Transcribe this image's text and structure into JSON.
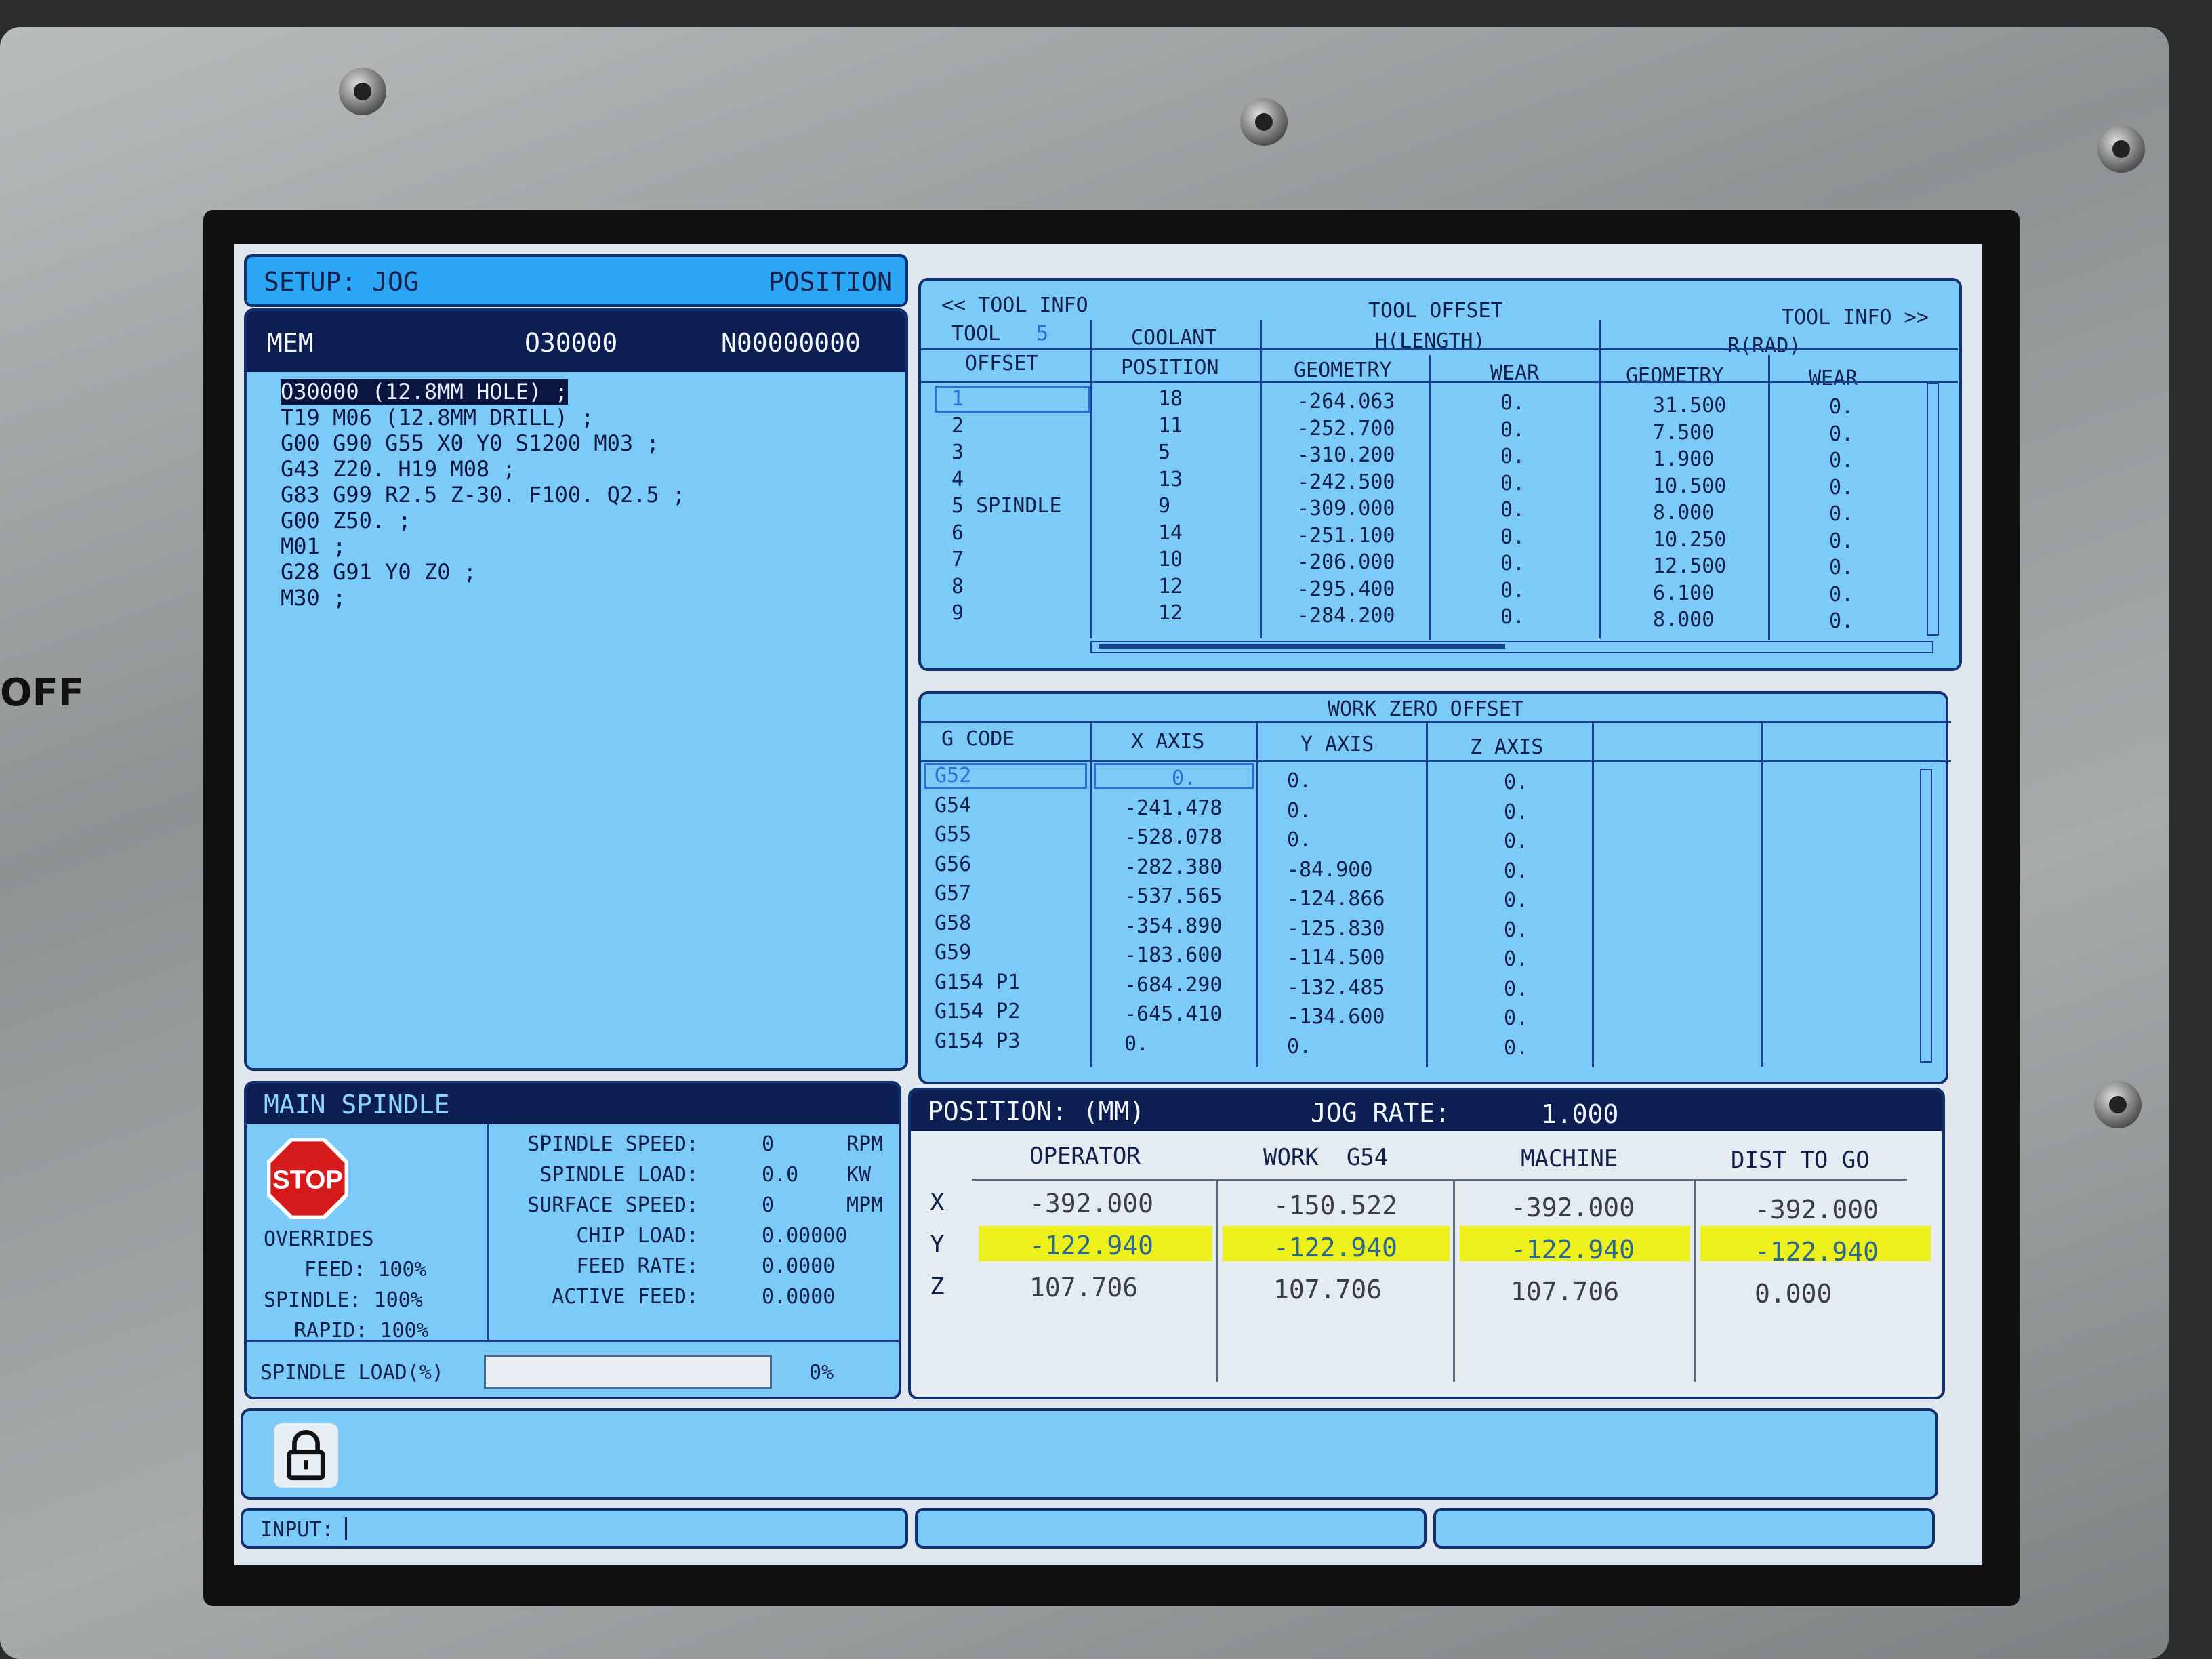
{
  "header": {
    "mode": "SETUP: JOG",
    "page": "POSITION"
  },
  "program": {
    "mode": "MEM",
    "program_number": "O30000",
    "sequence_number": "N00000000",
    "lines": [
      "O30000 (12.8MM HOLE) ;",
      "T19 M06 (12.8MM DRILL) ;",
      "G00 G90 G55 X0 Y0 S1200 M03 ;",
      "G43 Z20. H19 M08 ;",
      "G83 G99 R2.5 Z-30. F100. Q2.5 ;",
      "G00 Z50. ;",
      "M01 ;",
      "G28 G91 Y0 Z0 ;",
      "M30 ;"
    ]
  },
  "tool_offset": {
    "nav_left": "<< TOOL INFO",
    "title": "TOOL OFFSET",
    "nav_right": "TOOL INFO >>",
    "tool_label": "TOOL",
    "tool_value": "5",
    "offset_label": "OFFSET",
    "coolant_label": "COOLANT",
    "position_label": "POSITION",
    "h_length": "H(LENGTH)",
    "r_rad": "R(RAD)",
    "geometry": "GEOMETRY",
    "wear": "WEAR",
    "rows": [
      {
        "offset": "1",
        "coolant": "18",
        "h_geo": "-264.063",
        "h_wear": "0.",
        "r_geo": "31.500",
        "r_wear": "0."
      },
      {
        "offset": "2",
        "coolant": "11",
        "h_geo": "-252.700",
        "h_wear": "0.",
        "r_geo": "7.500",
        "r_wear": "0."
      },
      {
        "offset": "3",
        "coolant": "5",
        "h_geo": "-310.200",
        "h_wear": "0.",
        "r_geo": "1.900",
        "r_wear": "0."
      },
      {
        "offset": "4",
        "coolant": "13",
        "h_geo": "-242.500",
        "h_wear": "0.",
        "r_geo": "10.500",
        "r_wear": "0."
      },
      {
        "offset": "5 SPINDLE",
        "coolant": "9",
        "h_geo": "-309.000",
        "h_wear": "0.",
        "r_geo": "8.000",
        "r_wear": "0."
      },
      {
        "offset": "6",
        "coolant": "14",
        "h_geo": "-251.100",
        "h_wear": "0.",
        "r_geo": "10.250",
        "r_wear": "0."
      },
      {
        "offset": "7",
        "coolant": "10",
        "h_geo": "-206.000",
        "h_wear": "0.",
        "r_geo": "12.500",
        "r_wear": "0."
      },
      {
        "offset": "8",
        "coolant": "12",
        "h_geo": "-295.400",
        "h_wear": "0.",
        "r_geo": "6.100",
        "r_wear": "0."
      },
      {
        "offset": "9",
        "coolant": "12",
        "h_geo": "-284.200",
        "h_wear": "0.",
        "r_geo": "8.000",
        "r_wear": "0."
      }
    ]
  },
  "work_zero": {
    "title": "WORK ZERO OFFSET",
    "col_gcode": "G CODE",
    "col_x": "X AXIS",
    "col_y": "Y AXIS",
    "col_z": "Z AXIS",
    "rows": [
      {
        "g": "G52",
        "x": "0.",
        "y": "0.",
        "z": "0."
      },
      {
        "g": "G54",
        "x": "-241.478",
        "y": "0.",
        "z": "0."
      },
      {
        "g": "G55",
        "x": "-528.078",
        "y": "0.",
        "z": "0."
      },
      {
        "g": "G56",
        "x": "-282.380",
        "y": "-84.900",
        "z": "0."
      },
      {
        "g": "G57",
        "x": "-537.565",
        "y": "-124.866",
        "z": "0."
      },
      {
        "g": "G58",
        "x": "-354.890",
        "y": "-125.830",
        "z": "0."
      },
      {
        "g": "G59",
        "x": "-183.600",
        "y": "-114.500",
        "z": "0."
      },
      {
        "g": "G154 P1",
        "x": "-684.290",
        "y": "-132.485",
        "z": "0."
      },
      {
        "g": "G154 P2",
        "x": "-645.410",
        "y": "-134.600",
        "z": "0."
      },
      {
        "g": "G154 P3",
        "x": "0.",
        "y": "0.",
        "z": "0."
      }
    ]
  },
  "spindle": {
    "title": "MAIN SPINDLE",
    "stop_label": "STOP",
    "overrides": "OVERRIDES",
    "feed": "FEED: 100%",
    "spindle_ovr": "SPINDLE: 100%",
    "rapid": "RAPID: 100%",
    "stats": [
      {
        "label": "SPINDLE SPEED:",
        "value": "0",
        "unit": "RPM"
      },
      {
        "label": "SPINDLE LOAD:",
        "value": "0.0",
        "unit": "KW"
      },
      {
        "label": "SURFACE SPEED:",
        "value": "0",
        "unit": "MPM"
      },
      {
        "label": "CHIP LOAD:",
        "value": "0.00000",
        "unit": ""
      },
      {
        "label": "FEED RATE:",
        "value": "0.0000",
        "unit": ""
      },
      {
        "label": "ACTIVE FEED:",
        "value": "0.0000",
        "unit": ""
      }
    ],
    "load_label": "SPINDLE LOAD(%)",
    "load_value": "0%",
    "load_fraction": 0
  },
  "position": {
    "title": "POSITION: (MM)",
    "jog_label": "JOG RATE:",
    "jog_value": "1.000",
    "cols": [
      "OPERATOR",
      "WORK  G54",
      "MACHINE",
      "DIST TO GO"
    ],
    "rows": [
      {
        "axis": "X",
        "vals": [
          "-392.000",
          "-150.522",
          "-392.000",
          "-392.000"
        ]
      },
      {
        "axis": "Y",
        "vals": [
          "-122.940",
          "-122.940",
          "-122.940",
          "-122.940"
        ]
      },
      {
        "axis": "Z",
        "vals": [
          "107.706",
          "107.706",
          "107.706",
          "0.000"
        ]
      }
    ]
  },
  "input": {
    "label": "INPUT:"
  },
  "bezel": {
    "off_label": "OFF"
  }
}
